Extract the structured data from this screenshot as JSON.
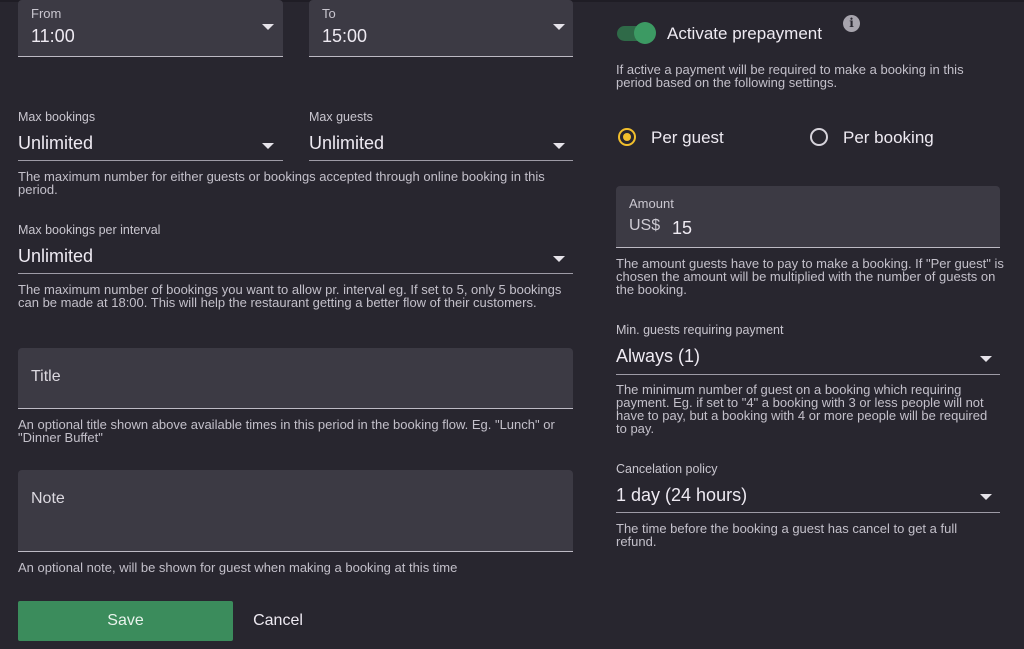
{
  "left": {
    "from": {
      "label": "From",
      "value": "11:00"
    },
    "to": {
      "label": "To",
      "value": "15:00"
    },
    "max_bookings": {
      "label": "Max bookings",
      "value": "Unlimited"
    },
    "max_guests": {
      "label": "Max guests",
      "value": "Unlimited"
    },
    "max_help": "The maximum number for either guests or bookings accepted through online booking in this period.",
    "max_per_interval": {
      "label": "Max bookings per interval",
      "value": "Unlimited",
      "help": "The maximum number of bookings you want to allow pr. interval eg. If set to 5, only 5 bookings can be made at 18:00. This will help the restaurant getting a better flow of their customers."
    },
    "title": {
      "placeholder": "Title",
      "value": "",
      "help": "An optional title shown above available times in this period in the booking flow. Eg. \"Lunch\" or \"Dinner Buffet\""
    },
    "note": {
      "placeholder": "Note",
      "value": "",
      "help": "An optional note, will be shown for guest when making a booking at this time"
    },
    "save_label": "Save",
    "cancel_label": "Cancel"
  },
  "right": {
    "prepayment": {
      "label": "Activate prepayment",
      "enabled": true,
      "info_icon": "info-icon",
      "help": "If active a payment will be required to make a booking in this period based on the following settings."
    },
    "payment_mode": {
      "options": [
        {
          "label": "Per guest",
          "selected": true
        },
        {
          "label": "Per booking",
          "selected": false
        }
      ]
    },
    "amount": {
      "label": "Amount",
      "currency": "US$",
      "value": "15",
      "help": "The amount guests have to pay to make a booking. If \"Per guest\" is chosen the amount will be multiplied with the number of guests on the booking."
    },
    "min_guests": {
      "label": "Min. guests requiring payment",
      "value": "Always (1)",
      "help": "The minimum number of guest on a booking which requiring payment. Eg. if set to \"4\" a booking with 3 or less people will not have to pay, but a booking with 4 or more people will be required to pay."
    },
    "cancelation": {
      "label": "Cancelation policy",
      "value": "1 day (24 hours)",
      "help": "The time before the booking a guest has cancel to get a full refund."
    }
  },
  "colors": {
    "background": "#28262f",
    "field_fill": "#3c3a44",
    "accent_green": "#3b8c5c",
    "radio_yellow": "#f2bf2c"
  }
}
